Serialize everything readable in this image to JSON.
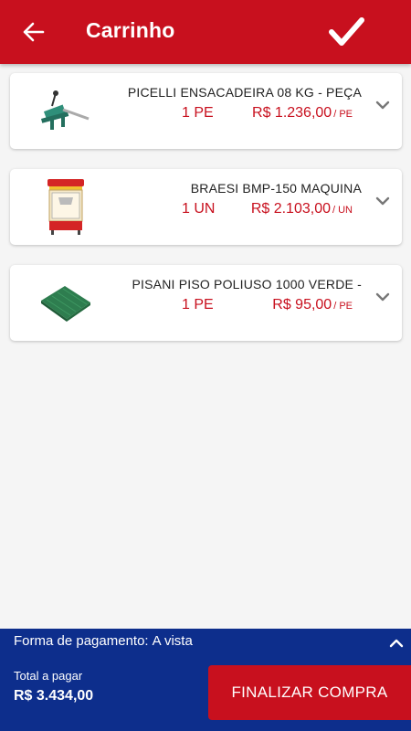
{
  "app": {
    "title": "Carrinho",
    "accent_color": "#c8101e",
    "footer_color": "#0d2e8c"
  },
  "icons": {
    "back": "arrow-left-icon",
    "confirm": "check-icon",
    "expand": "chevron-down-icon",
    "collapse": "chevron-up-icon"
  },
  "cart": {
    "items": [
      {
        "name": "PICELLI ENSACADEIRA 08 KG - PEÇA",
        "quantity": "1 PE",
        "price": "R$ 1.236,00",
        "unit": "/ PE",
        "image": "bagging-machine-image"
      },
      {
        "name": "BRAESI BMP-150 MAQUINA",
        "quantity": "1 UN",
        "price": "R$ 2.103,00",
        "unit": "/ UN",
        "image": "popcorn-machine-image"
      },
      {
        "name": "PISANI PISO POLIUSO 1000 VERDE -",
        "quantity": "1 PE",
        "price": "R$ 95,00",
        "unit": "/ PE",
        "image": "green-floor-tile-image"
      }
    ]
  },
  "footer": {
    "payment_label": "Forma de pagamento:",
    "payment_value": "A vista",
    "total_label": "Total a pagar",
    "total_value": "R$ 3.434,00",
    "finalize_label": "FINALIZAR COMPRA"
  }
}
